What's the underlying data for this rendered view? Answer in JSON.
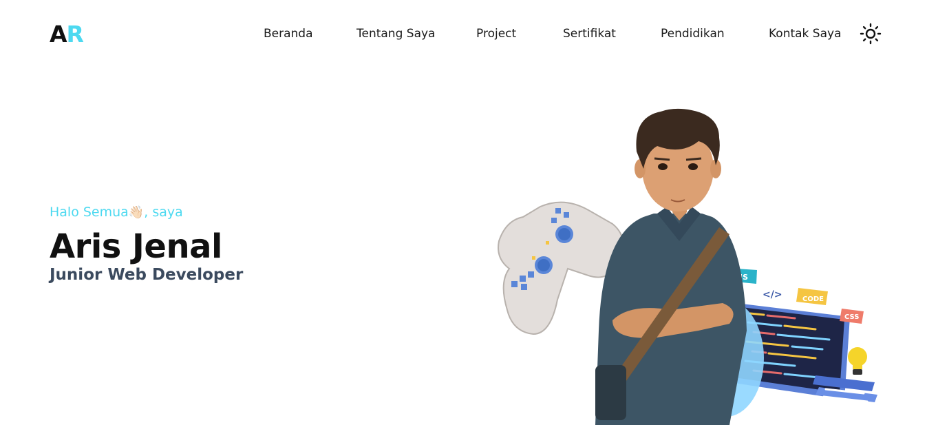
{
  "logo": {
    "first": "A",
    "second": "R"
  },
  "nav": {
    "items": [
      {
        "label": "Beranda"
      },
      {
        "label": "Tentang Saya"
      },
      {
        "label": "Project"
      },
      {
        "label": "Sertifikat"
      },
      {
        "label": "Pendidikan"
      },
      {
        "label": "Kontak Saya"
      }
    ],
    "theme_icon": "sun-icon"
  },
  "hero": {
    "greeting_before": "Halo Semua",
    "greeting_emoji": "👋🏻",
    "greeting_after": ", saya",
    "name": "Aris Jenal",
    "role": "Junior Web Developer"
  },
  "illustration": {
    "badges": {
      "js": "JS",
      "code_tag": "</>",
      "code": "CODE",
      "css": "CSS"
    },
    "icons": [
      "gamepad-icon",
      "lightbulb-icon",
      "code-editor-icon"
    ]
  },
  "colors": {
    "accent": "#4dd9f0",
    "text": "#111111",
    "role": "#3b4a5e"
  }
}
